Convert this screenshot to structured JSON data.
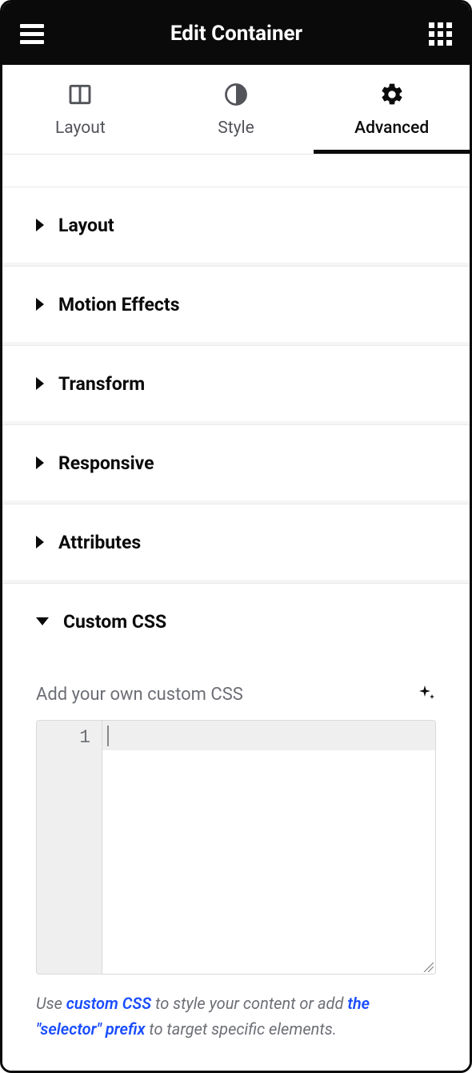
{
  "header": {
    "title": "Edit Container"
  },
  "tabs": {
    "layout": "Layout",
    "style": "Style",
    "advanced": "Advanced"
  },
  "accordion": {
    "layout": "Layout",
    "motion_effects": "Motion Effects",
    "transform": "Transform",
    "responsive": "Responsive",
    "attributes": "Attributes",
    "custom_css": "Custom CSS"
  },
  "custom_css": {
    "label": "Add your own custom CSS",
    "line_number": "1",
    "hint_prefix": "Use ",
    "hint_link1": "custom CSS",
    "hint_mid": " to style your content or add ",
    "hint_link2": "the \"selector\" prefix",
    "hint_suffix": " to target specific elements."
  }
}
